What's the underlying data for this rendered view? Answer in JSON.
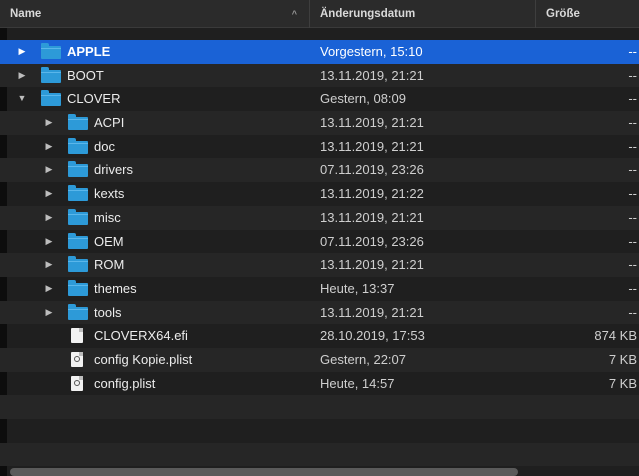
{
  "header": {
    "name": "Name",
    "date": "Änderungsdatum",
    "size": "Größe",
    "sort_glyph": "^"
  },
  "rows": [
    {
      "name": "APPLE",
      "date": "Vorgestern, 15:10",
      "size": "--",
      "type": "folder",
      "level": 0,
      "expanded": false,
      "selected": true
    },
    {
      "name": "BOOT",
      "date": "13.11.2019, 21:21",
      "size": "--",
      "type": "folder",
      "level": 0,
      "expanded": false
    },
    {
      "name": "CLOVER",
      "date": "Gestern, 08:09",
      "size": "--",
      "type": "folder",
      "level": 0,
      "expanded": true
    },
    {
      "name": "ACPI",
      "date": "13.11.2019, 21:21",
      "size": "--",
      "type": "folder",
      "level": 1,
      "expanded": false
    },
    {
      "name": "doc",
      "date": "13.11.2019, 21:21",
      "size": "--",
      "type": "folder",
      "level": 1,
      "expanded": false
    },
    {
      "name": "drivers",
      "date": "07.11.2019, 23:26",
      "size": "--",
      "type": "folder",
      "level": 1,
      "expanded": false
    },
    {
      "name": "kexts",
      "date": "13.11.2019, 21:22",
      "size": "--",
      "type": "folder",
      "level": 1,
      "expanded": false
    },
    {
      "name": "misc",
      "date": "13.11.2019, 21:21",
      "size": "--",
      "type": "folder",
      "level": 1,
      "expanded": false
    },
    {
      "name": "OEM",
      "date": "07.11.2019, 23:26",
      "size": "--",
      "type": "folder",
      "level": 1,
      "expanded": false
    },
    {
      "name": "ROM",
      "date": "13.11.2019, 21:21",
      "size": "--",
      "type": "folder",
      "level": 1,
      "expanded": false
    },
    {
      "name": "themes",
      "date": "Heute, 13:37",
      "size": "--",
      "type": "folder",
      "level": 1,
      "expanded": false
    },
    {
      "name": "tools",
      "date": "13.11.2019, 21:21",
      "size": "--",
      "type": "folder",
      "level": 1,
      "expanded": false
    },
    {
      "name": "CLOVERX64.efi",
      "date": "28.10.2019, 17:53",
      "size": "874 KB",
      "type": "file",
      "level": 1
    },
    {
      "name": "config Kopie.plist",
      "date": "Gestern, 22:07",
      "size": "7 KB",
      "type": "plist",
      "level": 1
    },
    {
      "name": "config.plist",
      "date": "Heute, 14:57",
      "size": "7 KB",
      "type": "plist",
      "level": 1
    }
  ],
  "icons": {
    "folder": "folder-icon",
    "file": "document-icon",
    "plist": "plist-document-icon",
    "collapsed": "▶",
    "expanded": "▼"
  },
  "colors": {
    "selection": "#1a62d6",
    "folder": "#2d9ad8",
    "background": "#1f1f1f",
    "stripe": "#262626"
  }
}
